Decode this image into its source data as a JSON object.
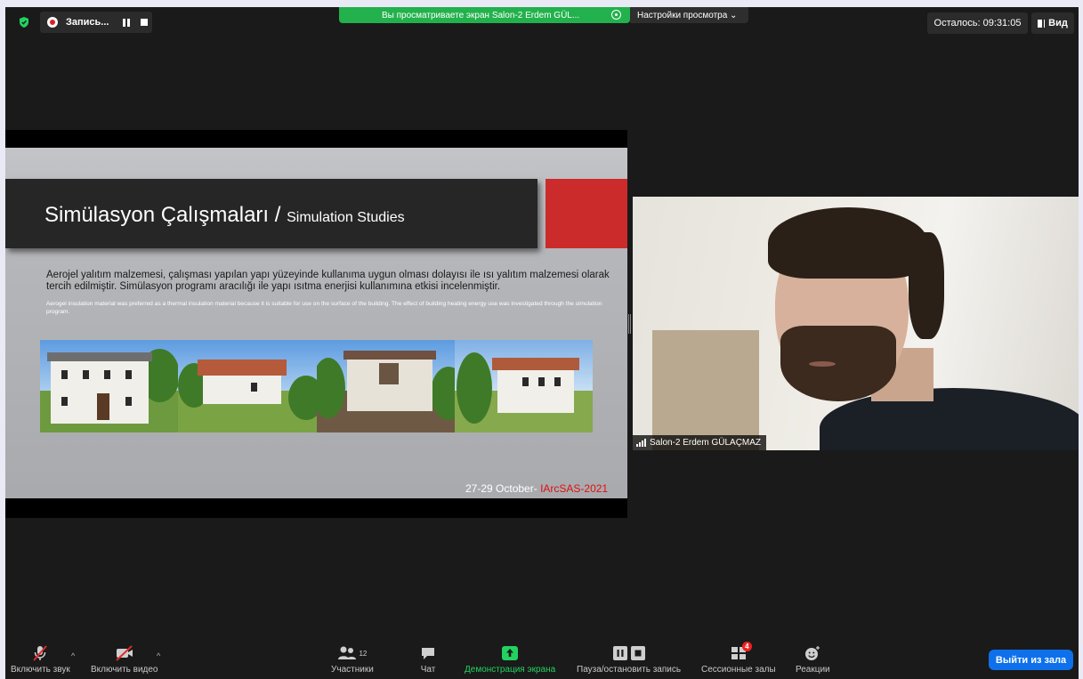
{
  "topbar": {
    "recording_label": "Запись...",
    "share_banner": "Вы просматриваете экран Salon-2 Erdem GÜL...",
    "view_settings": "Настройки просмотра ⌄",
    "time_left": "Осталось: 09:31:05",
    "view_label": "Вид"
  },
  "slide": {
    "title_main": "Simülasyon Çalışmaları /",
    "title_sub": "Simulation Studies",
    "text_tr": "Aerojel yalıtım malzemesi, çalışması yapılan yapı yüzeyinde kullanıma uygun olması dolayısı ile ısı yalıtım malzemesi olarak tercih edilmiştir. Simülasyon programı aracılığı ile yapı ısıtma enerjisi kullanımına etkisi incelenmiştir.",
    "text_en": "Aerogel insulation material was preferred as a thermal insulation material because it is suitable for use on the surface of the building. The effect of building heating energy use was investigated through the simulation program.",
    "footer_date": "27-29 October-",
    "footer_conf": "IArcSAS-2021"
  },
  "video": {
    "participant_name": "Salon-2 Erdem GÜLAÇMAZ"
  },
  "toolbar": {
    "audio": "Включить звук",
    "video": "Включить видео",
    "participants": "Участники",
    "participants_count": "12",
    "chat": "Чат",
    "share": "Демонстрация экрана",
    "record": "Пауза/остановить запись",
    "breakout": "Сессионные залы",
    "breakout_badge": "4",
    "reactions": "Реакции",
    "leave": "Выйти из зала"
  }
}
